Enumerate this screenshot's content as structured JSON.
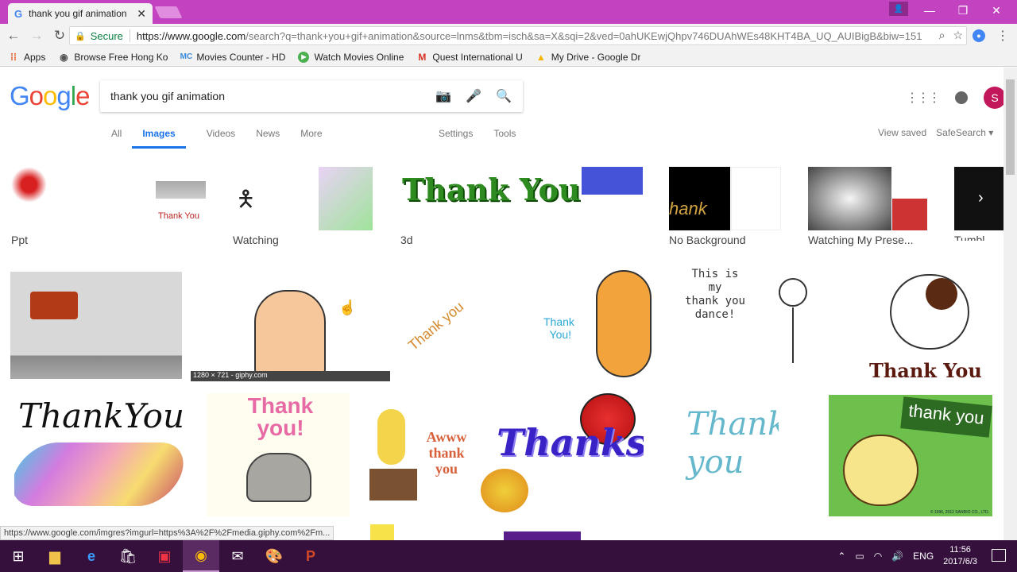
{
  "browser": {
    "tab_title": "thank you gif animation",
    "tab_favicon": "G",
    "tab_close": "✕",
    "url_secure": "Secure",
    "url_base": "https://www.google.com",
    "url_rest": "/search?q=thank+you+gif+animation&source=lnms&tbm=isch&sa=X&sqi=2&ved=0ahUKEwjQhpv746DUAhWEs48KHT4BA_UQ_AUIBigB&biw=151",
    "bookmarks": [
      {
        "label": "Apps",
        "icon": "apps-icon"
      },
      {
        "label": "Browse Free Hong Ko",
        "icon": "globe-icon"
      },
      {
        "label": "Movies Counter - HD",
        "icon": "mc-icon"
      },
      {
        "label": "Watch Movies Online",
        "icon": "play-icon"
      },
      {
        "label": "Quest International U",
        "icon": "gmail-icon"
      },
      {
        "label": "My Drive - Google Dr",
        "icon": "drive-icon"
      }
    ],
    "status_url": "https://www.google.com/imgres?imgurl=https%3A%2F%2Fmedia.giphy.com%2Fm..."
  },
  "google": {
    "logo": "Google",
    "query": "thank you gif animation",
    "avatar_letter": "S",
    "tabs": [
      {
        "label": "All"
      },
      {
        "label": "Images",
        "active": true
      },
      {
        "label": "Videos"
      },
      {
        "label": "News"
      },
      {
        "label": "More"
      }
    ],
    "settings": "Settings",
    "tools": "Tools",
    "view_saved": "View saved",
    "safesearch": "SafeSearch ▾",
    "related": [
      {
        "label": "Ppt"
      },
      {
        "label": "Watching"
      },
      {
        "label": "3d"
      },
      {
        "label": "No Background"
      },
      {
        "label": "Watching My Prese..."
      },
      {
        "label": "Tumbl"
      }
    ],
    "hover_caption": "1280 × 721 - giphy.com",
    "images": {
      "row2": {
        "thank_you_stick": [
          "This is",
          "my",
          "thank you",
          "dance!"
        ],
        "thank_you_dog": "Thank You",
        "corgi": "Thank\nYou!",
        "curved": "Thank you",
        "rainbow": "ThankYou!",
        "cat": "Thank you!",
        "duck": "Awww thank you",
        "thanks": "Thanks",
        "script": "Thank you",
        "green": "thank you",
        "green_footer": "© 1996, 2012 SANRIO CO., LTD."
      }
    }
  },
  "taskbar": {
    "lang": "ENG",
    "time": "11:56",
    "date": "2017/6/3"
  },
  "colors": {
    "titlebar": "#c342c0",
    "taskbar": "#35103d",
    "accent": "#1a73e8"
  }
}
